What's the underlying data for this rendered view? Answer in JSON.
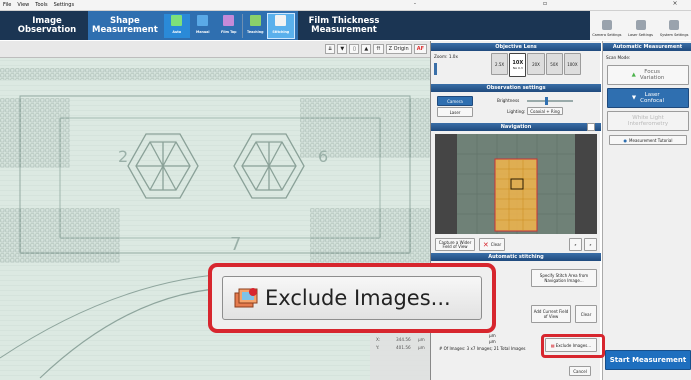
{
  "menu": {
    "items": [
      "File",
      "View",
      "Tools",
      "Settings"
    ]
  },
  "window_controls": [
    "-",
    "▫",
    "×"
  ],
  "modes": {
    "image": "Image\nObservation",
    "shape": "Shape\nMeasurement",
    "film": "Film Thickness\nMeasurement"
  },
  "shape_tools": [
    "Auto",
    "Manual",
    "Film Top",
    "Teaching",
    "Stitching"
  ],
  "right_toolbar": [
    "Camera Settings",
    "Laser Settings",
    "System Settings"
  ],
  "viewer_tools": {
    "z_origin": "Z Origin",
    "af": "AF"
  },
  "objective": {
    "header": "Objective Lens",
    "zoom_label": "Zoom: 1.0x",
    "lenses": [
      "2.5X",
      "10X",
      "20X",
      "50X",
      "100X"
    ],
    "lens_sub": [
      "",
      "NA 0.3",
      "",
      "",
      ""
    ]
  },
  "observation": {
    "header": "Observation settings",
    "camera": "Camera",
    "laser": "Laser",
    "brightness": "Brightness",
    "lighting": "Lighting:",
    "lighting_value": "Coaxial + Ring"
  },
  "navigation": {
    "header": "Navigation",
    "capture": "Capture a Wider Field of View",
    "clear": "Clear"
  },
  "stitching": {
    "header": "Automatic stitching",
    "specify": "Specify Stitch Area from Navigation Image...",
    "add_fov": "Add Current Field of View",
    "clear": "Clear",
    "unit1": "μm",
    "unit2": "μm",
    "count": "# Of Images: 3 x7 Images; 21 Total Images",
    "exclude": "Exclude Images...",
    "cancel": "Cancel"
  },
  "coords": {
    "x_label": "X:",
    "x_value": "344.56",
    "y_label": "Y:",
    "y_value": "401.56",
    "unit": "μm"
  },
  "auto": {
    "header": "Automatic Measurement",
    "scan_mode": "Scan Mode:",
    "focus": "Focus\nVariation",
    "laser": "Laser\nConfocal",
    "white": "White Light\nInterferometry",
    "tutorial": "Measurement Tutorial",
    "start": "Start Measurement"
  },
  "callout": {
    "label": "Exclude Images..."
  },
  "colors": {
    "accent_red": "#d7262e",
    "navy": "#1b3553",
    "active_blue": "#2f6fb0",
    "start_blue": "#1e6fbf",
    "stitch_orange": "#f3b64c"
  }
}
